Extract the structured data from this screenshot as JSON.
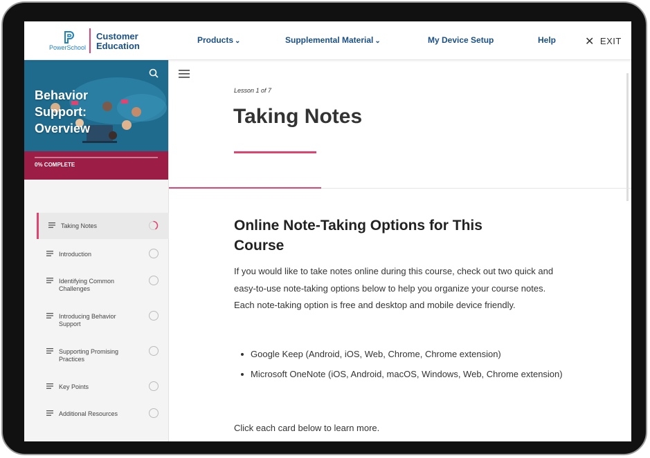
{
  "header": {
    "logo_text": "PowerSchool",
    "brand_title_line1": "Customer",
    "brand_title_line2": "Education",
    "nav": [
      {
        "label": "Products",
        "has_dropdown": true
      },
      {
        "label": "Supplemental Material",
        "has_dropdown": true
      },
      {
        "label": "My Device Setup",
        "has_dropdown": false
      },
      {
        "label": "Help",
        "has_dropdown": false
      }
    ],
    "exit_label": "EXIT"
  },
  "sidebar": {
    "course_title_line1": "Behavior",
    "course_title_line2": "Support:",
    "course_title_line3": "Overview",
    "progress_label": "0% COMPLETE",
    "progress_percent": 0,
    "lessons": [
      {
        "line1": "Taking Notes",
        "line2": "",
        "active": true
      },
      {
        "line1": "Introduction",
        "line2": "",
        "active": false
      },
      {
        "line1": "Identifying Common",
        "line2": "Challenges",
        "active": false
      },
      {
        "line1": "Introducing Behavior",
        "line2": "Support",
        "active": false
      },
      {
        "line1": "Supporting Promising",
        "line2": "Practices",
        "active": false
      },
      {
        "line1": "Key Points",
        "line2": "",
        "active": false
      },
      {
        "line1": "Additional Resources",
        "line2": "",
        "active": false
      }
    ]
  },
  "main": {
    "lesson_count": "Lesson 1 of 7",
    "lesson_title": "Taking Notes",
    "heading_line1": "Online Note-Taking Options for This",
    "heading_line2": "Course",
    "paragraph": "If you would like to take notes online during this course, check out two quick and easy-to-use note-taking options below to help you organize your course notes. Each note-taking option is free and desktop and mobile device friendly.",
    "bullets": [
      "Google Keep (Android, iOS, Web, Chrome, Chrome extension)",
      "Microsoft OneNote (iOS, Android, macOS, Windows, Web, Chrome extension)"
    ],
    "click_text": "Click each card below to learn more."
  },
  "colors": {
    "accent": "#e0436f",
    "brand_blue": "#1a4f86",
    "progress_bg": "#9c1d45",
    "hero_bg": "#1e6b8e"
  },
  "icons": [
    "powerschool-logo-icon",
    "chevron-down-icon",
    "close-icon",
    "search-icon",
    "menu-icon",
    "list-icon",
    "progress-circle-icon"
  ]
}
